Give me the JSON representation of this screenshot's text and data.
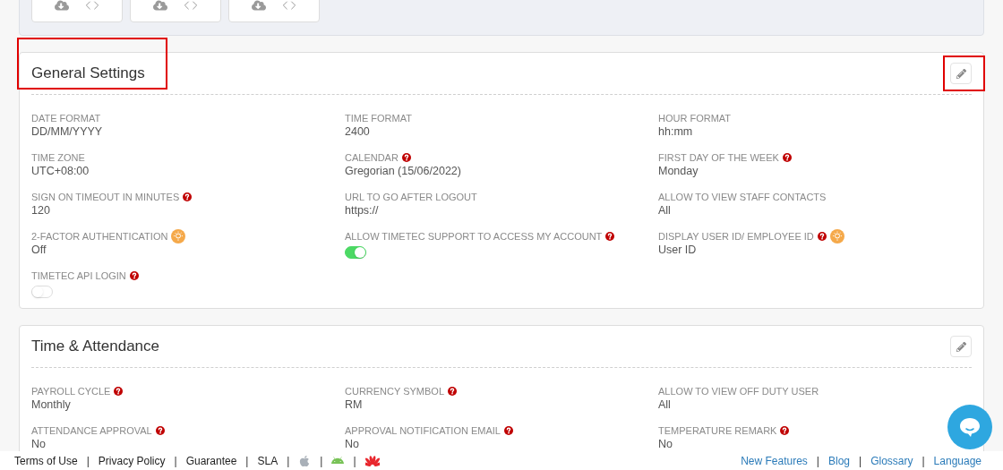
{
  "top_panel": {
    "cards": [
      {
        "kind": "export"
      },
      {
        "kind": "export"
      },
      {
        "kind": "export"
      }
    ]
  },
  "sections": [
    {
      "title": "General Settings",
      "title_highlighted": true,
      "edit_highlighted": true,
      "fields": [
        {
          "kind": "text",
          "label": "DATE FORMAT",
          "value": "DD/MM/YYYY",
          "help": false,
          "tip": false
        },
        {
          "kind": "text",
          "label": "TIME FORMAT",
          "value": "2400",
          "help": false,
          "tip": false
        },
        {
          "kind": "text",
          "label": "HOUR FORMAT",
          "value": "hh:mm",
          "help": false,
          "tip": false
        },
        {
          "kind": "text",
          "label": "TIME ZONE",
          "value": "UTC+08:00",
          "help": false,
          "tip": false
        },
        {
          "kind": "text",
          "label": "CALENDAR",
          "value": "Gregorian (15/06/2022)",
          "help": true,
          "tip": false
        },
        {
          "kind": "text",
          "label": "FIRST DAY OF THE WEEK",
          "value": "Monday",
          "help": true,
          "tip": false
        },
        {
          "kind": "text",
          "label": "SIGN ON TIMEOUT IN MINUTES",
          "value": "120",
          "help": true,
          "tip": false
        },
        {
          "kind": "text",
          "label": "URL TO GO AFTER LOGOUT",
          "value": "https://",
          "help": false,
          "tip": false
        },
        {
          "kind": "text",
          "label": "ALLOW TO VIEW STAFF CONTACTS",
          "value": "All",
          "help": false,
          "tip": false
        },
        {
          "kind": "text",
          "label": "2-FACTOR AUTHENTICATION",
          "value": "Off",
          "help": false,
          "tip": true
        },
        {
          "kind": "toggle",
          "label": "ALLOW TIMETEC SUPPORT TO ACCESS MY ACCOUNT",
          "on": true,
          "help": true,
          "tip": false
        },
        {
          "kind": "text",
          "label": "DISPLAY USER ID/ EMPLOYEE ID",
          "value": "User ID",
          "help": true,
          "tip": true
        },
        {
          "kind": "toggle",
          "label": "TIMETEC API LOGIN",
          "on": false,
          "help": true,
          "tip": false
        }
      ]
    },
    {
      "title": "Time & Attendance",
      "title_highlighted": false,
      "edit_highlighted": false,
      "fields": [
        {
          "kind": "text",
          "label": "PAYROLL CYCLE",
          "value": "Monthly",
          "help": true,
          "tip": false
        },
        {
          "kind": "text",
          "label": "CURRENCY SYMBOL",
          "value": "RM",
          "help": true,
          "tip": false
        },
        {
          "kind": "text",
          "label": "ALLOW TO VIEW OFF DUTY USER",
          "value": "All",
          "help": false,
          "tip": false
        },
        {
          "kind": "text",
          "label": "ATTENDANCE APPROVAL",
          "value": "No",
          "help": true,
          "tip": false
        },
        {
          "kind": "text",
          "label": "APPROVAL NOTIFICATION EMAIL",
          "value": "No",
          "help": true,
          "tip": false
        },
        {
          "kind": "text",
          "label": "TEMPERATURE REMARK",
          "value": "No",
          "help": true,
          "tip": false
        }
      ]
    }
  ],
  "footer": {
    "separator": "|",
    "left": [
      {
        "kind": "link",
        "text": "Terms of Use"
      },
      {
        "kind": "link",
        "text": "Privacy Policy"
      },
      {
        "kind": "link",
        "text": "Guarantee"
      },
      {
        "kind": "link",
        "text": "SLA"
      },
      {
        "kind": "apple"
      },
      {
        "kind": "android"
      },
      {
        "kind": "huawei"
      }
    ],
    "right": [
      "New Features",
      "Blog",
      "Glossary",
      "Language"
    ]
  }
}
